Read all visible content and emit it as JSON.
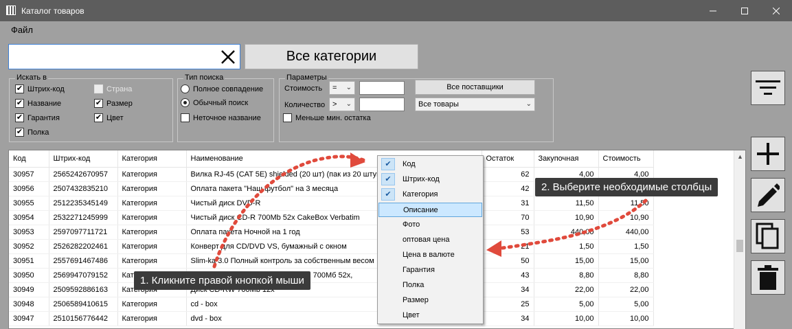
{
  "window": {
    "title": "Каталог товаров"
  },
  "menu": {
    "file": "Файл"
  },
  "search": {
    "value": "",
    "placeholder": ""
  },
  "category_button": "Все категории",
  "search_in": {
    "title": "Искать в",
    "barcode": "Штрих-код",
    "country": "Страна",
    "name": "Название",
    "size": "Размер",
    "warranty": "Гарантия",
    "color": "Цвет",
    "shelf": "Полка"
  },
  "search_type": {
    "title": "Тип поиска",
    "exact": "Полное совпадение",
    "normal": "Обычный поиск",
    "fuzzy": "Неточное название"
  },
  "params": {
    "title": "Параметры",
    "cost_label": "Стоимость",
    "cost_op": "=",
    "qty_label": "Количество",
    "qty_op": ">",
    "suppliers_button": "Все поставщики",
    "goods_select": "Все товары",
    "below_min": "Меньше мин. остатка"
  },
  "table": {
    "headers": [
      "Код",
      "Штрих-код",
      "Категория",
      "Наименование",
      "Остаток",
      "Закупочная",
      "Стоимость"
    ],
    "rows": [
      [
        "30957",
        "2565242670957",
        "Категория",
        "Вилка RJ-45 (CAT 5E) shielded (20 шт) (пак из 20 штук",
        "62",
        "4,00",
        "4,00"
      ],
      [
        "30956",
        "2507432835210",
        "Категория",
        "Оплата пакета \"Наш футбол\" на 3 месяца",
        "42",
        "",
        ""
      ],
      [
        "30955",
        "2512235345149",
        "Категория",
        "Чистый диск DVD-R",
        "31",
        "11,50",
        "11,50"
      ],
      [
        "30954",
        "2532271245999",
        "Категория",
        "Чистый диск CD-R 700Mb 52x CakeBox Verbatim",
        "70",
        "10,90",
        "10,90"
      ],
      [
        "30953",
        "2597097711721",
        "Категория",
        "Оплата пакета Ночной на 1 год",
        "53",
        "440,00",
        "440,00"
      ],
      [
        "30952",
        "2526282202461",
        "Категория",
        "Конверт для CD/DVD VS, бумажный с окном",
        "21",
        "1,50",
        "1,50"
      ],
      [
        "30951",
        "2557691467486",
        "Категория",
        "Slim-ka 3.0 Полный контроль за собственным весом",
        "50",
        "15,00",
        "15,00"
      ],
      [
        "30950",
        "2569947079152",
        "Категория",
        "Оптический диск CD-R VERBATIM 700Mб 52x,",
        "43",
        "8,80",
        "8,80"
      ],
      [
        "30949",
        "2509592886163",
        "Категория",
        "Диск CD-RW 700Mb 12x",
        "34",
        "22,00",
        "22,00"
      ],
      [
        "30948",
        "2506589410615",
        "Категория",
        "cd - box",
        "25",
        "5,00",
        "5,00"
      ],
      [
        "30947",
        "2510156776442",
        "Категория",
        "dvd - box",
        "34",
        "10,00",
        "10,00"
      ]
    ]
  },
  "context_menu": {
    "items": [
      "Код",
      "Штрих-код",
      "Категория",
      "Описание",
      "Фото",
      "оптовая цена",
      "Цена в валюте",
      "Гарантия",
      "Полка",
      "Размер",
      "Цвет"
    ],
    "checked": [
      true,
      true,
      true,
      false,
      false,
      false,
      false,
      false,
      false,
      false,
      false
    ],
    "highlighted_index": 3
  },
  "callouts": {
    "right_click": "1. Кликните правой кнопкой мыши",
    "choose_columns": "2. Выберите необходимые столбцы"
  },
  "colors": {
    "callout_bg": "#3b3b3b",
    "arrow": "#e04a3c",
    "highlight": "#cce8ff",
    "titlebar": "#5d5d5d",
    "background": "#a0a0a0"
  },
  "icons": {
    "filter": "filter-icon",
    "add": "plus-icon",
    "edit": "pencil-icon",
    "copy": "copy-icon",
    "delete": "trash-icon",
    "clear": "close-icon"
  }
}
